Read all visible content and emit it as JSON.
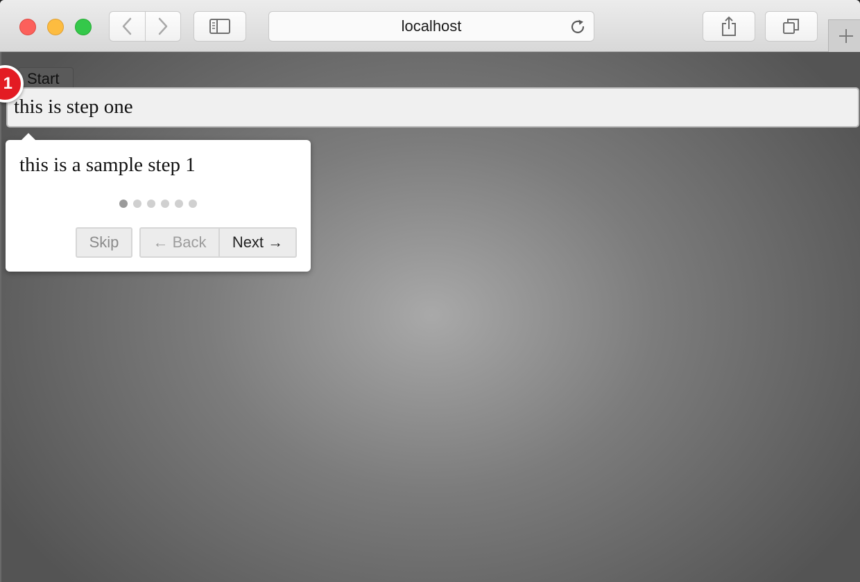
{
  "browser": {
    "url": "localhost",
    "icons": {
      "back": "chevron-left-icon",
      "forward": "chevron-right-icon",
      "sidebar": "sidebar-icon",
      "reload": "reload-icon",
      "share": "share-icon",
      "tabs": "tabs-overview-icon",
      "new_tab": "plus-icon"
    }
  },
  "page": {
    "start_label": "Start",
    "step_target_text": "this is step one",
    "tour": {
      "step_number": "1",
      "body": "this is a sample step 1",
      "total_steps": 6,
      "current_step": 1,
      "skip_label": "Skip",
      "back_label": "← Back",
      "next_label": "Next →"
    }
  },
  "colors": {
    "badge": "#e31b23",
    "traffic_close": "#fc605b",
    "traffic_minimize": "#fdbc40",
    "traffic_maximize": "#34c84a"
  }
}
